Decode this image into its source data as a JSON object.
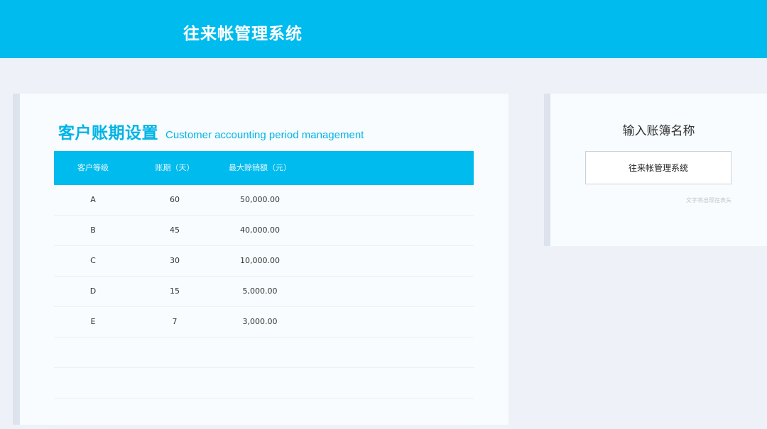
{
  "header": {
    "title": "往来帐管理系统"
  },
  "period_panel": {
    "title_zh": "客户账期设置",
    "title_en": "Customer accounting period management",
    "columns": [
      "客户等级",
      "账期（天）",
      "最大赊销额（元）"
    ],
    "rows": [
      [
        "A",
        "60",
        "50,000.00"
      ],
      [
        "B",
        "45",
        "40,000.00"
      ],
      [
        "C",
        "30",
        "10,000.00"
      ],
      [
        "D",
        "15",
        "5,000.00"
      ],
      [
        "E",
        "7",
        "3,000.00"
      ],
      [
        "",
        "",
        ""
      ],
      [
        "",
        "",
        ""
      ],
      [
        "",
        "",
        ""
      ]
    ]
  },
  "ledger_panel": {
    "label": "输入账簿名称",
    "input_value": "往来帐管理系统",
    "hint": "文字将出现在表头"
  },
  "colors": {
    "accent": "#00bbee",
    "background": "#eef2f8",
    "panel": "#f8fcfe"
  }
}
